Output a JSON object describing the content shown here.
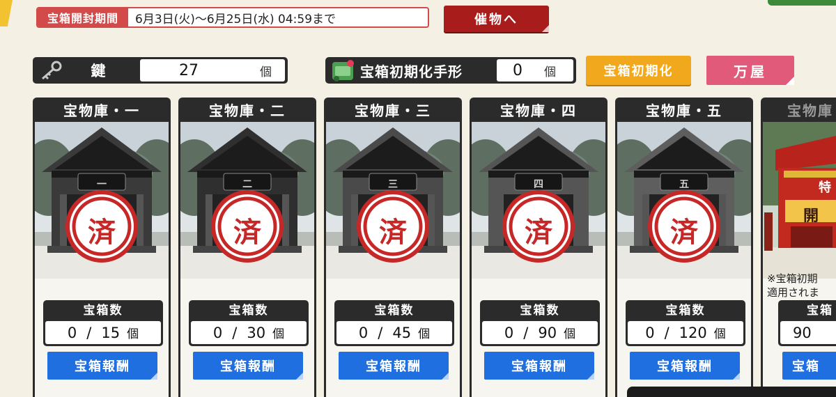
{
  "header": {
    "period_label": "宝箱開封期間",
    "period_value": "6月3日(火)〜6月25日(水) 04:59まで",
    "event_button": "催物へ"
  },
  "resources": {
    "key_label": "鍵",
    "key_count": "27",
    "key_unit": "個",
    "ticket_label": "宝箱初期化手形",
    "ticket_count": "0",
    "ticket_unit": "個"
  },
  "actions": {
    "reset_button": "宝箱初期化",
    "shop_button": "万屋"
  },
  "vault_labels": {
    "count_label": "宝箱数",
    "reward_button": "宝箱報酬",
    "done_mark": "済",
    "unit": "個",
    "separator": "/"
  },
  "vaults": [
    {
      "title": "宝物庫・一",
      "plaque": "一",
      "opened": "0",
      "total": "15"
    },
    {
      "title": "宝物庫・二",
      "plaque": "二",
      "opened": "0",
      "total": "30"
    },
    {
      "title": "宝物庫・三",
      "plaque": "三",
      "opened": "0",
      "total": "45"
    },
    {
      "title": "宝物庫・四",
      "plaque": "四",
      "opened": "0",
      "total": "90"
    },
    {
      "title": "宝物庫・五",
      "plaque": "五",
      "opened": "0",
      "total": "120"
    }
  ],
  "vault_partial": {
    "title": "宝物庫",
    "plaque": "特",
    "open_label": "開",
    "note_line1": "※宝箱初期",
    "note_line2": "適用されま",
    "count_label": "宝箱",
    "count_value": "90",
    "reward_button": "宝箱"
  },
  "colors": {
    "accent_red": "#d24a4a",
    "event_red": "#a81c1c",
    "reset_orange": "#f2a81c",
    "shop_pink": "#e25a7a",
    "reward_blue": "#1f6fe0",
    "panel_dark": "#2b2b2b"
  },
  "icons": {
    "key": "key-icon",
    "ticket": "scroll-ticket-icon"
  }
}
